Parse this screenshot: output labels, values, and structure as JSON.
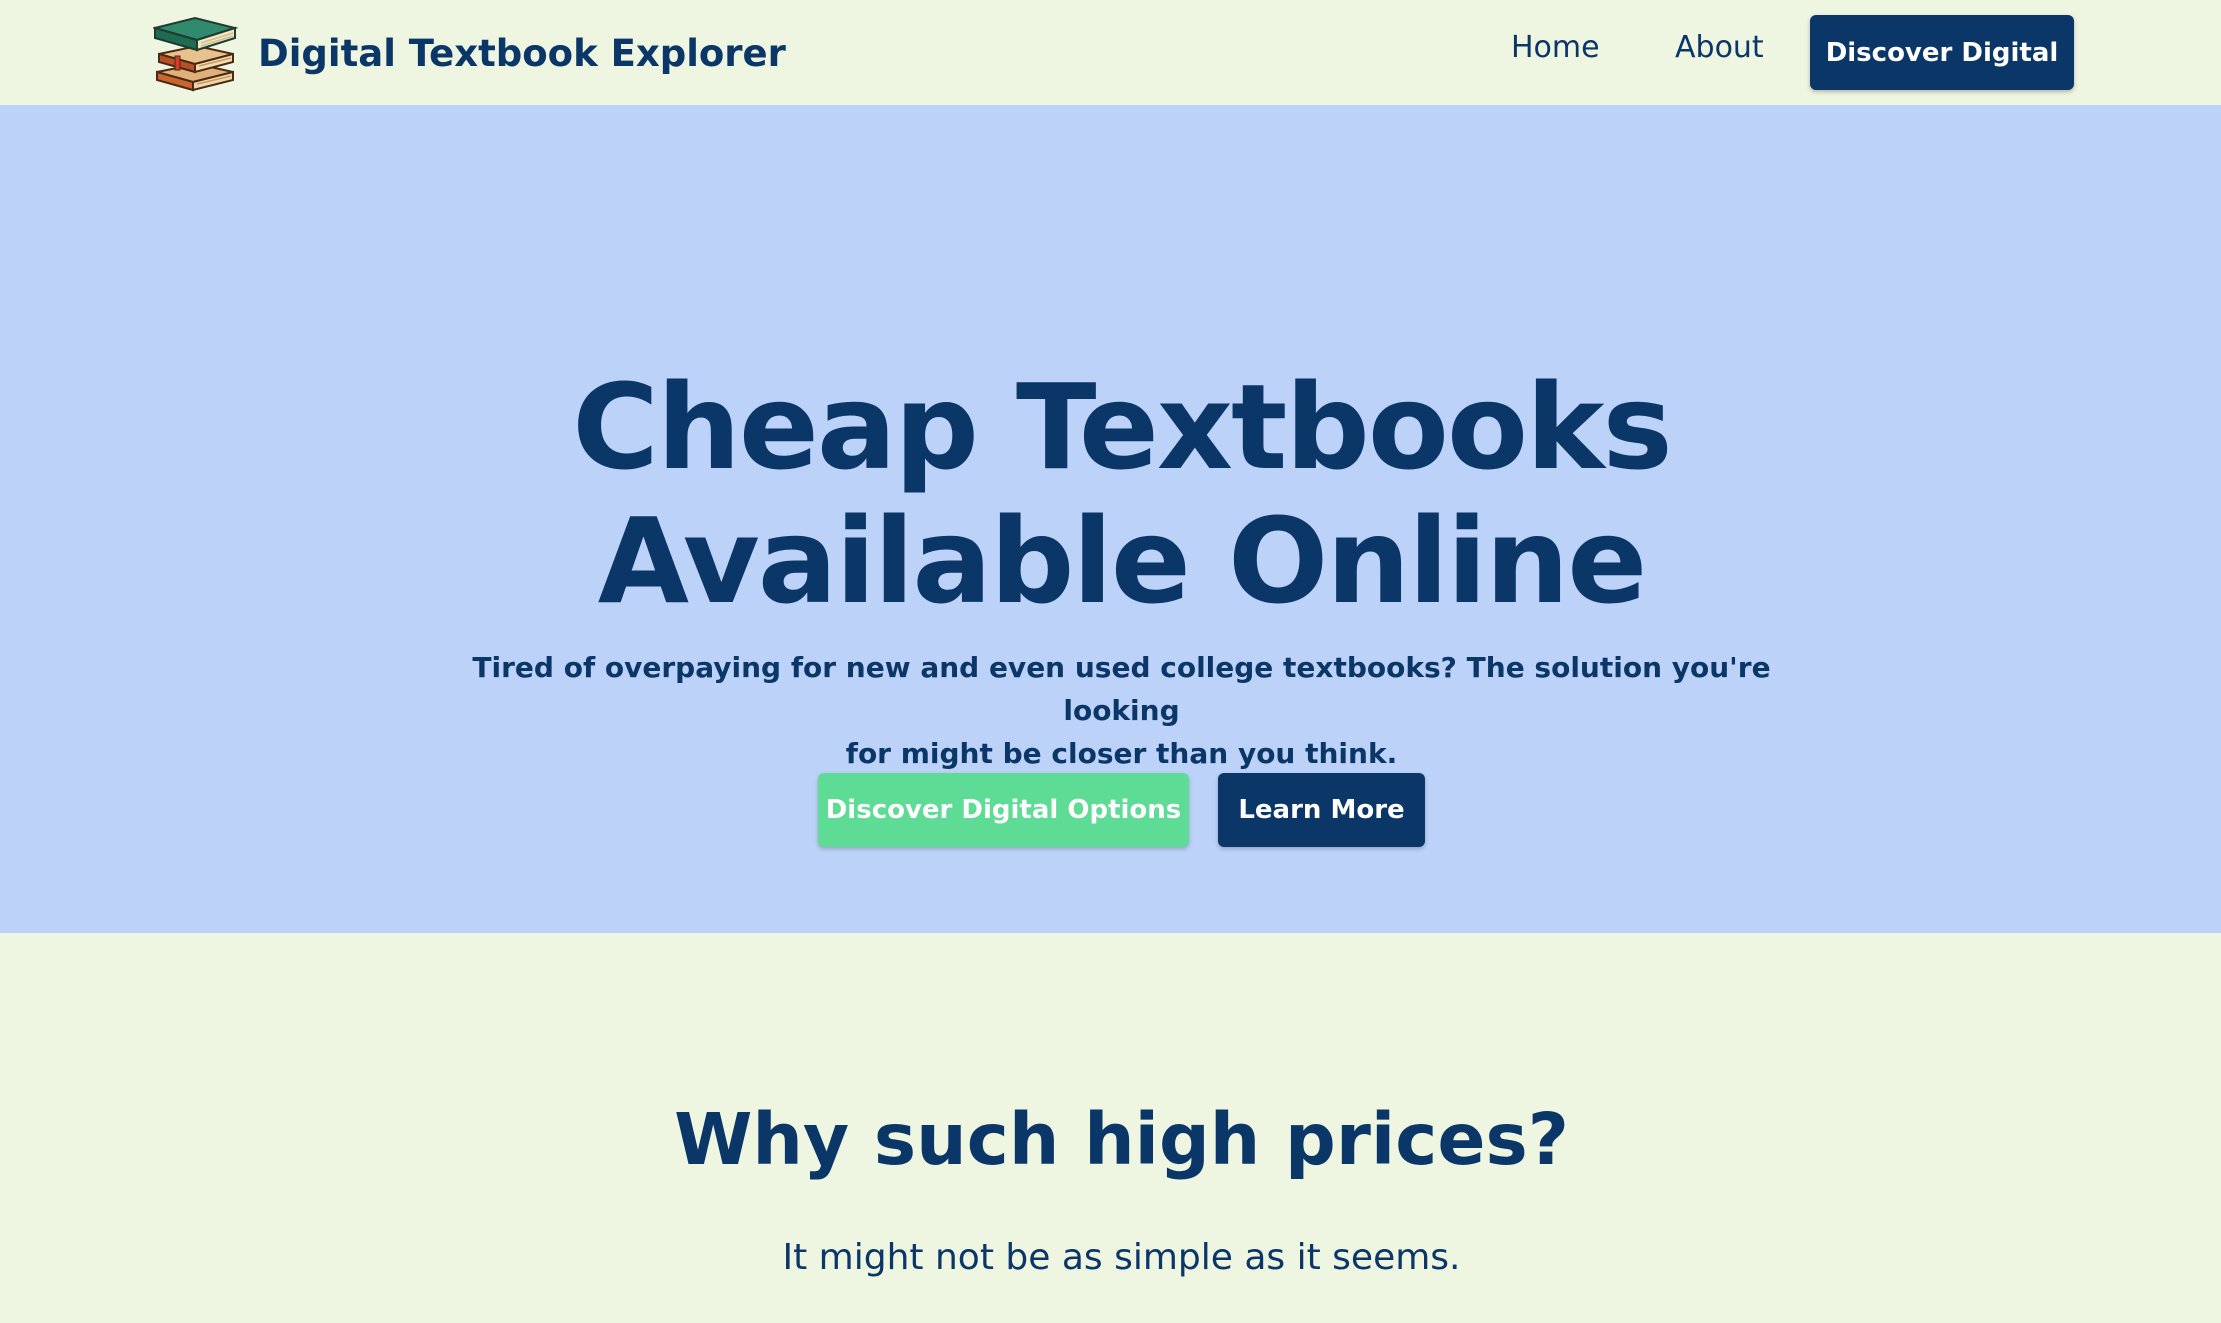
{
  "nav": {
    "brand": "Digital Textbook Explorer",
    "brand_icon": "stacked-books-icon",
    "links": [
      "Home",
      "About"
    ],
    "cta_label": "Discover Digital"
  },
  "hero": {
    "title_line1": "Cheap Textbooks",
    "title_line2": "Available Online",
    "subtitle_line1": "Tired of overpaying for new and even used college textbooks? The solution you're looking",
    "subtitle_line2": "for might be closer than you think.",
    "primary_button": "Discover Digital Options",
    "secondary_button": "Learn More"
  },
  "section": {
    "title": "Why such high prices?",
    "subtitle": "It might not be as simple as it seems."
  },
  "colors": {
    "page_background": "#EEF5E0",
    "hero_background": "#BDD2F8",
    "navy": "#0B3668",
    "green": "#5EDB94",
    "white": "#FFFFFF"
  }
}
